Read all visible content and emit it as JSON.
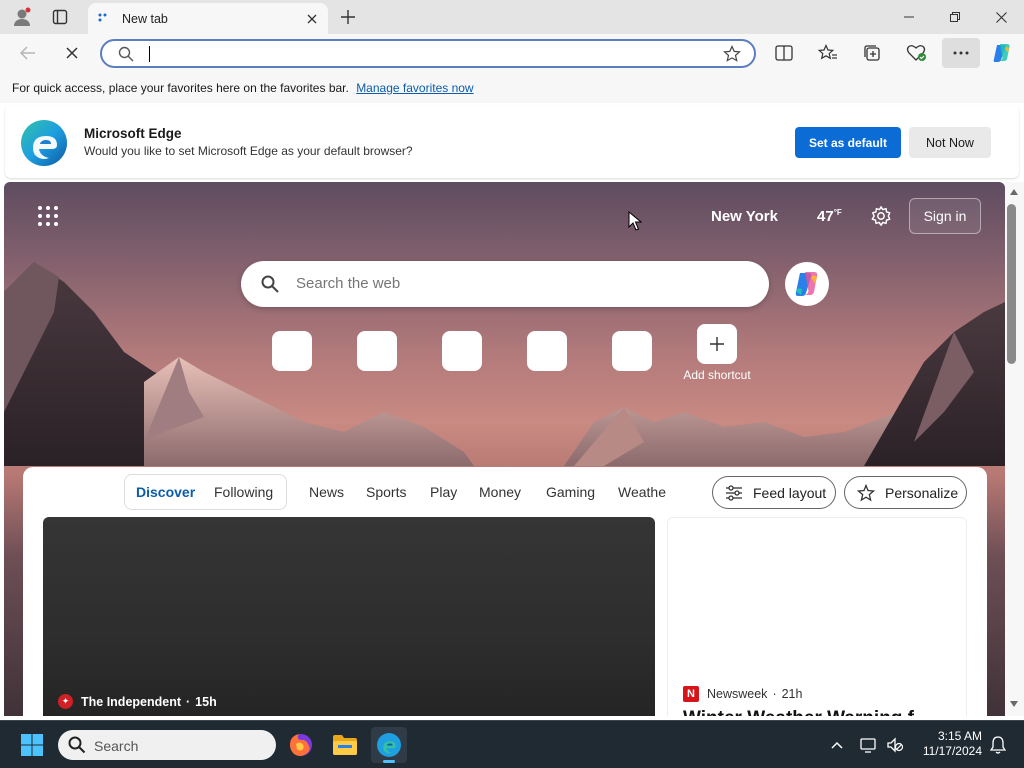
{
  "browser": {
    "tab": {
      "title": "New tab"
    },
    "address_bar": {
      "value": "",
      "placeholder": ""
    },
    "favorites_bar": {
      "message": "For quick access, place your favorites here on the favorites bar.",
      "link": "Manage favorites now"
    }
  },
  "default_banner": {
    "title": "Microsoft Edge",
    "message": "Would you like to set Microsoft Edge as your default browser?",
    "primary_button": "Set as default",
    "secondary_button": "Not Now"
  },
  "newtab": {
    "weather": {
      "city": "New York",
      "temperature": "47",
      "unit": "°F"
    },
    "sign_in": "Sign in",
    "search_placeholder": "Search the web",
    "add_shortcut_label": "Add shortcut"
  },
  "feed": {
    "tabs": [
      "Discover",
      "Following",
      "News",
      "Sports",
      "Play",
      "Money",
      "Gaming",
      "Weathe"
    ],
    "active_tab": "Discover",
    "feed_layout": "Feed layout",
    "personalize": "Personalize",
    "main_card": {
      "source": "The Independent",
      "age": "15h"
    },
    "side_card": {
      "source": "Newsweek",
      "age": "21h",
      "headline": "Winter Weather Warning f"
    }
  },
  "taskbar": {
    "search_label": "Search",
    "time": "3:15 AM",
    "date": "11/17/2024"
  },
  "colors": {
    "accent": "#0b6cd6",
    "link": "#0b5cad",
    "taskbar": "#1f2a33"
  }
}
